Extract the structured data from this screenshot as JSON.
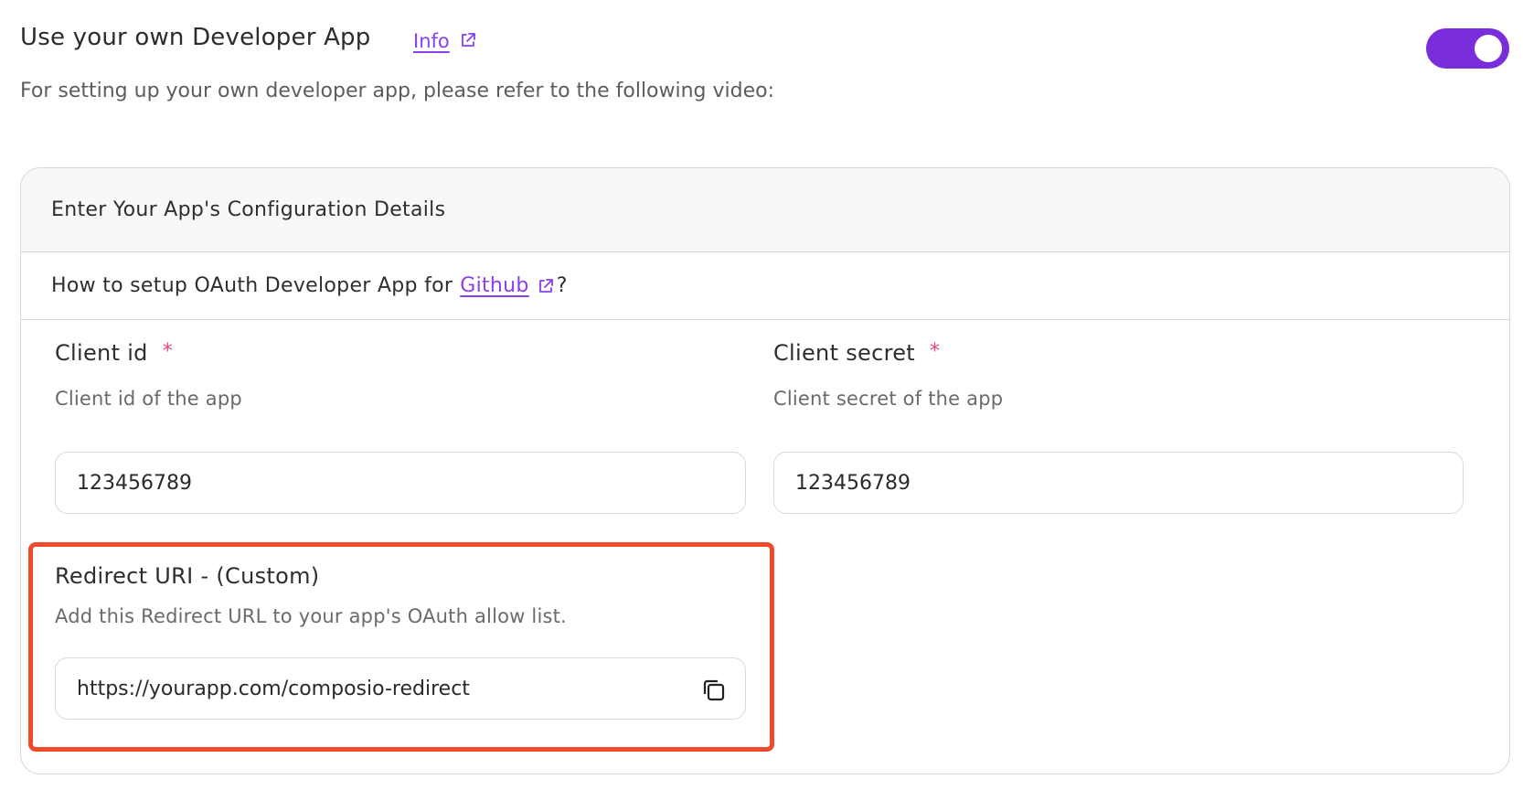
{
  "header": {
    "title": "Use your own Developer App",
    "info_link": "Info",
    "subtitle": "For setting up your own developer app, please refer to the following video:",
    "toggle_on": true
  },
  "card": {
    "header": "Enter Your App's Configuration Details",
    "how_prefix": "How to setup OAuth Developer App for",
    "how_link": "Github",
    "how_suffix": "?"
  },
  "fields": {
    "client_id": {
      "label": "Client id",
      "required_mark": "*",
      "description": "Client id of the app",
      "value": "123456789"
    },
    "client_secret": {
      "label": "Client secret",
      "required_mark": "*",
      "description": "Client secret of the app",
      "value": "123456789"
    },
    "redirect_uri": {
      "label": "Redirect URI - (Custom)",
      "description": "Add this Redirect URL to your app's OAuth allow list.",
      "value": "https://yourapp.com/composio-redirect"
    }
  },
  "colors": {
    "accent": "#7a2ddb",
    "link": "#8a3ff0",
    "required": "#e8467a",
    "highlight": "#f04a2a"
  },
  "icons": [
    "external-link-icon",
    "copy-icon"
  ]
}
